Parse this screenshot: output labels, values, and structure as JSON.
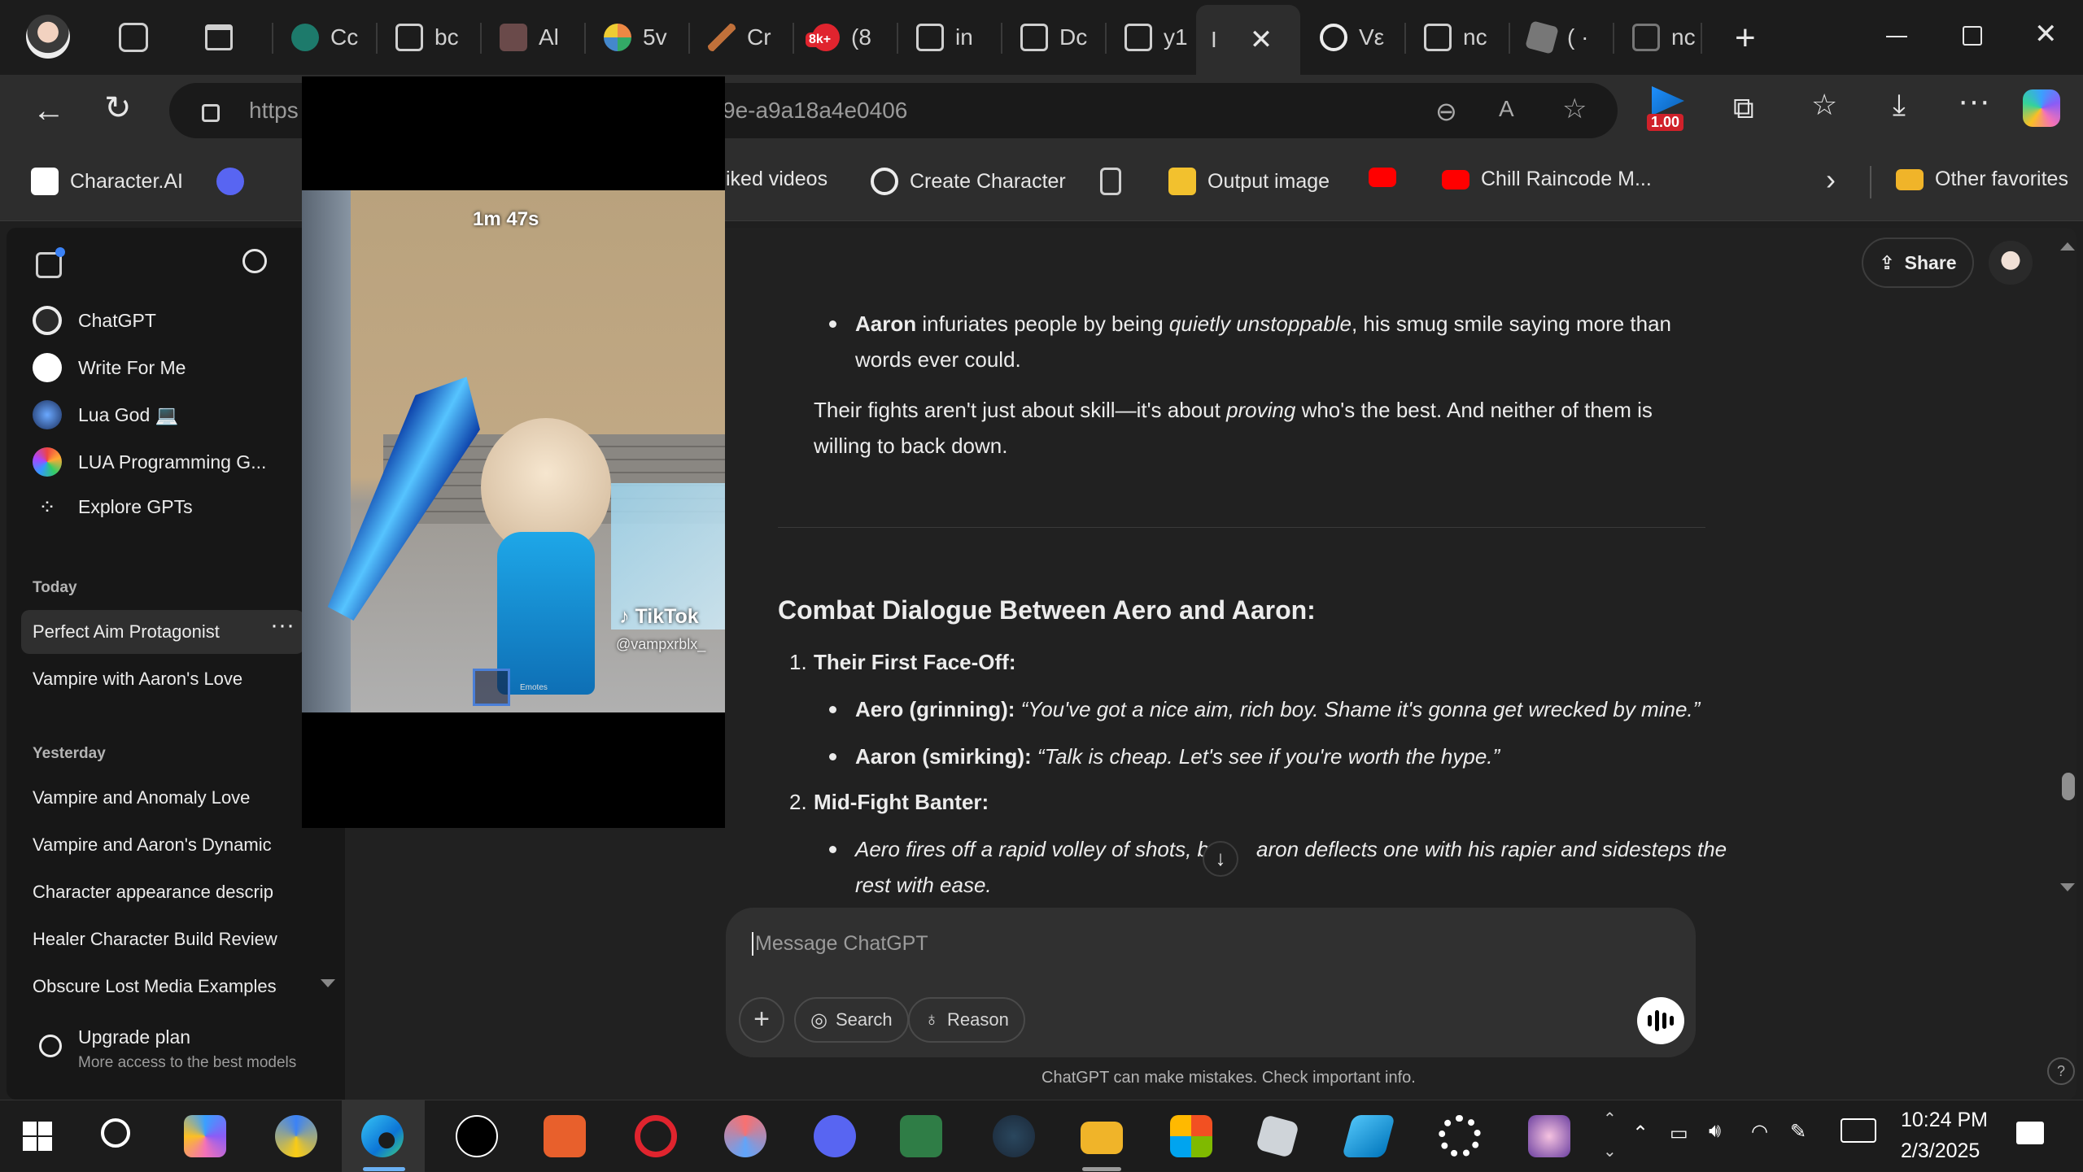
{
  "browser": {
    "tabs": [
      {
        "label": "Cc",
        "color": "#1d7a6b"
      },
      {
        "label": "bc",
        "color": "#555"
      },
      {
        "label": "Al",
        "color": "#6a4a4a"
      },
      {
        "label": "5v",
        "color": "#2b8a3e"
      },
      {
        "label": "Cr",
        "color": "#c0703a"
      },
      {
        "label": "(8",
        "color": "#e0242e"
      },
      {
        "label": "in",
        "color": "#555"
      },
      {
        "label": "Dc",
        "color": "#555"
      },
      {
        "label": "y1",
        "color": "#555"
      },
      {
        "label": "I",
        "color": "#333"
      },
      {
        "label": "Vε",
        "color": "#ececec"
      },
      {
        "label": "nc",
        "color": "#555"
      },
      {
        "label": "( ·",
        "color": "#777"
      },
      {
        "label": "nc",
        "color": "#555"
      }
    ],
    "badge_notifications": "8k+",
    "address_left": "https",
    "address_right": "9e-a9a18a4e0406",
    "extension_badge": "1.00",
    "bookmarks": [
      {
        "label": "Character.AI",
        "icon": "cai-icon"
      },
      {
        "label": "iked videos",
        "icon": ""
      },
      {
        "label": "Create Character",
        "icon": "openai-icon"
      },
      {
        "label": "Output image",
        "icon": "y-icon"
      },
      {
        "label": "Chill Raincode M...",
        "icon": "youtube-icon"
      },
      {
        "label": "Other favorites",
        "icon": "folder-icon"
      }
    ]
  },
  "sidebar": {
    "gpts": [
      {
        "label": "ChatGPT"
      },
      {
        "label": "Write For Me"
      },
      {
        "label": "Lua God 💻"
      },
      {
        "label": "LUA Programming G..."
      },
      {
        "label": "Explore GPTs"
      }
    ],
    "today_heading": "Today",
    "today": [
      "Perfect Aim Protagonist",
      "Vampire with Aaron's Love"
    ],
    "yesterday_heading": "Yesterday",
    "yesterday": [
      "Vampire and Anomaly Love",
      "Vampire and Aaron's Dynamic",
      "Character appearance descrip",
      "Healer Character Build Review",
      "Obscure Lost Media Examples"
    ],
    "upgrade_title": "Upgrade plan",
    "upgrade_sub": "More access to the best models"
  },
  "header": {
    "share_label": "Share"
  },
  "conversation": {
    "aaron_name": "Aaron",
    "aaron_line_a": " infuriates people by being ",
    "aaron_line_em": "quietly unstoppable",
    "aaron_line_b": ", his smug smile saying more than",
    "aaron_line_2": "words ever could.",
    "fights_a": "Their fights aren't just about skill—it's about ",
    "fights_em": "proving",
    "fights_b": " who's the best. And neither of them is",
    "fights_2": "willing to back down.",
    "heading": "Combat Dialogue Between Aero and Aaron:",
    "item1_num": "1.",
    "item1": "Their First Face-Off:",
    "aero_speaker": "Aero (grinning):",
    "aero_quote": " “You've got a nice aim, rich boy. Shame it's gonna get wrecked by mine.”",
    "aaron_speaker": "Aaron (smirking):",
    "aaron_quote": " “Talk is cheap. Let's see if you're worth the hype.”",
    "item2_num": "2.",
    "item2": "Mid-Fight Banter:",
    "action_1a": "Aero fires off a rapid volley of shots, b",
    "action_1b": "aron deflects one with his rapier and sidesteps the",
    "action_2": "rest with ease."
  },
  "composer": {
    "placeholder": "Message ChatGPT",
    "search_label": "Search",
    "reason_label": "Reason"
  },
  "disclaimer": "ChatGPT can make mistakes. Check important info.",
  "video": {
    "timer": "1m 47s",
    "tiktok_label": "TikTok",
    "tiktok_handle": "@vampxrblx_",
    "emotes_label": "Emotes"
  },
  "taskbar": {
    "time": "10:24 PM",
    "date": "2/3/2025"
  }
}
